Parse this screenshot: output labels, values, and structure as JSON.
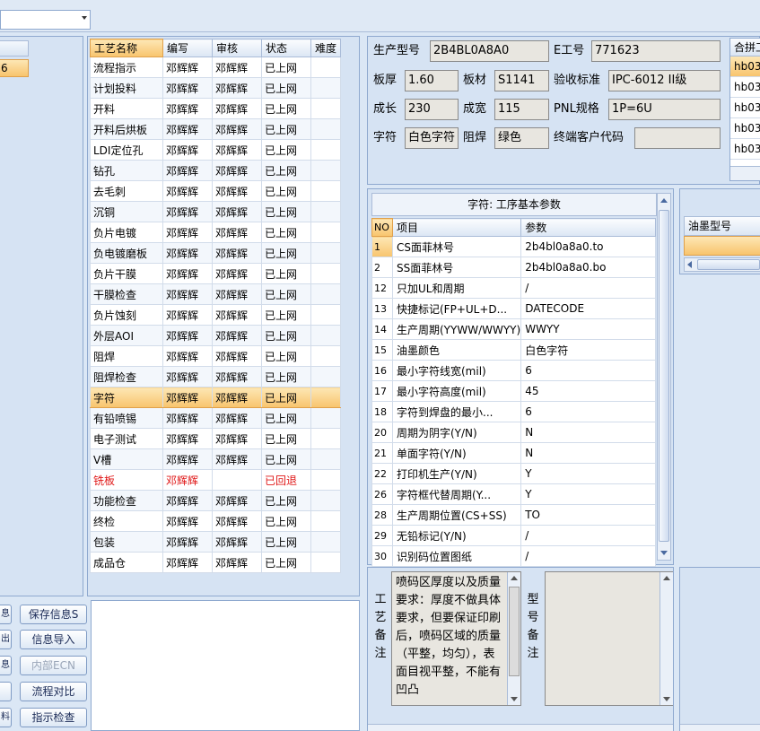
{
  "left": {
    "selected_fragment": "6",
    "buttons": [
      {
        "stub": "息",
        "label": "保存信息S",
        "disabled": false
      },
      {
        "stub": "出",
        "label": "信息导入",
        "disabled": false
      },
      {
        "stub": "息",
        "label": "内部ECN",
        "disabled": true
      },
      {
        "stub": "",
        "label": "流程对比",
        "disabled": false
      },
      {
        "stub": "料",
        "label": "指示检查",
        "disabled": false
      }
    ]
  },
  "process": {
    "headers": [
      "工艺名称",
      "编写",
      "审核",
      "状态",
      "难度"
    ],
    "rows": [
      {
        "name": "流程指示",
        "author": "邓辉辉",
        "reviewer": "邓辉辉",
        "status": "已上网"
      },
      {
        "name": "计划投料",
        "author": "邓辉辉",
        "reviewer": "邓辉辉",
        "status": "已上网"
      },
      {
        "name": "开料",
        "author": "邓辉辉",
        "reviewer": "邓辉辉",
        "status": "已上网"
      },
      {
        "name": "开料后烘板",
        "author": "邓辉辉",
        "reviewer": "邓辉辉",
        "status": "已上网"
      },
      {
        "name": "LDI定位孔",
        "author": "邓辉辉",
        "reviewer": "邓辉辉",
        "status": "已上网"
      },
      {
        "name": "钻孔",
        "author": "邓辉辉",
        "reviewer": "邓辉辉",
        "status": "已上网"
      },
      {
        "name": "去毛刺",
        "author": "邓辉辉",
        "reviewer": "邓辉辉",
        "status": "已上网"
      },
      {
        "name": "沉铜",
        "author": "邓辉辉",
        "reviewer": "邓辉辉",
        "status": "已上网"
      },
      {
        "name": "负片电镀",
        "author": "邓辉辉",
        "reviewer": "邓辉辉",
        "status": "已上网"
      },
      {
        "name": "负电镀磨板",
        "author": "邓辉辉",
        "reviewer": "邓辉辉",
        "status": "已上网"
      },
      {
        "name": "负片干膜",
        "author": "邓辉辉",
        "reviewer": "邓辉辉",
        "status": "已上网"
      },
      {
        "name": "干膜检查",
        "author": "邓辉辉",
        "reviewer": "邓辉辉",
        "status": "已上网"
      },
      {
        "name": "负片蚀刻",
        "author": "邓辉辉",
        "reviewer": "邓辉辉",
        "status": "已上网"
      },
      {
        "name": "外层AOI",
        "author": "邓辉辉",
        "reviewer": "邓辉辉",
        "status": "已上网"
      },
      {
        "name": "阻焊",
        "author": "邓辉辉",
        "reviewer": "邓辉辉",
        "status": "已上网"
      },
      {
        "name": "阻焊检查",
        "author": "邓辉辉",
        "reviewer": "邓辉辉",
        "status": "已上网"
      },
      {
        "name": "字符",
        "author": "邓辉辉",
        "reviewer": "邓辉辉",
        "status": "已上网",
        "active": true
      },
      {
        "name": "有铅喷锡",
        "author": "邓辉辉",
        "reviewer": "邓辉辉",
        "status": "已上网"
      },
      {
        "name": "电子测试",
        "author": "邓辉辉",
        "reviewer": "邓辉辉",
        "status": "已上网"
      },
      {
        "name": "V槽",
        "author": "邓辉辉",
        "reviewer": "邓辉辉",
        "status": "已上网"
      },
      {
        "name": "铣板",
        "author": "邓辉辉",
        "reviewer": "",
        "status": "已回退",
        "red": true
      },
      {
        "name": "功能检查",
        "author": "邓辉辉",
        "reviewer": "邓辉辉",
        "status": "已上网"
      },
      {
        "name": "终检",
        "author": "邓辉辉",
        "reviewer": "邓辉辉",
        "status": "已上网"
      },
      {
        "name": "包装",
        "author": "邓辉辉",
        "reviewer": "邓辉辉",
        "status": "已上网"
      },
      {
        "name": "成品仓",
        "author": "邓辉辉",
        "reviewer": "邓辉辉",
        "status": "已上网"
      }
    ]
  },
  "info": {
    "model_label": "生产型号",
    "model_value": "2B4BL0A8A0",
    "eng_label": "E工号",
    "eng_value": "771623",
    "thickness_label": "板厚",
    "thickness_value": "1.60",
    "material_label": "板材",
    "material_value": "S1141",
    "standard_label": "验收标准",
    "standard_value": "IPC-6012 II级",
    "length_label": "成长",
    "length_value": "230",
    "width_label": "成宽",
    "width_value": "115",
    "pnl_label": "PNL规格",
    "pnl_value": "1P=6U",
    "char_label": "字符",
    "char_value": "白色字符",
    "mask_label": "阻焊",
    "mask_value": "绿色",
    "customer_label": "终端客户代码",
    "customer_value": ""
  },
  "merge_list": {
    "header": "合拼工",
    "rows": [
      "hb03",
      "hb03",
      "hb03",
      "hb03",
      "hb03"
    ]
  },
  "params": {
    "title": "字符: 工序基本参数",
    "headers": [
      "NO",
      "项目",
      "参数"
    ],
    "rows": [
      {
        "no": "1",
        "item": "CS面菲林号",
        "value": "2b4bl0a8a0.to",
        "active": true
      },
      {
        "no": "2",
        "item": "SS面菲林号",
        "value": "2b4bl0a8a0.bo"
      },
      {
        "no": "12",
        "item": "只加UL和周期",
        "value": "/"
      },
      {
        "no": "13",
        "item": "快捷标记(FP+UL+D...",
        "value": "DATECODE"
      },
      {
        "no": "14",
        "item": "生产周期(YYWW/WWYY)",
        "value": "WWYY"
      },
      {
        "no": "15",
        "item": "油墨颜色",
        "value": "白色字符"
      },
      {
        "no": "16",
        "item": "最小字符线宽(mil)",
        "value": "6"
      },
      {
        "no": "17",
        "item": "最小字符高度(mil)",
        "value": "45"
      },
      {
        "no": "18",
        "item": "字符到焊盘的最小...",
        "value": "6"
      },
      {
        "no": "20",
        "item": "周期为阴字(Y/N)",
        "value": "N"
      },
      {
        "no": "21",
        "item": "单面字符(Y/N)",
        "value": "N"
      },
      {
        "no": "22",
        "item": "打印机生产(Y/N)",
        "value": "Y"
      },
      {
        "no": "26",
        "item": "字符框代替周期(Y...",
        "value": "Y"
      },
      {
        "no": "28",
        "item": "生产周期位置(CS+SS)",
        "value": "TO"
      },
      {
        "no": "29",
        "item": "无铅标记(Y/N)",
        "value": "/"
      },
      {
        "no": "30",
        "item": "识别码位置图纸",
        "value": "/"
      }
    ]
  },
  "ink": {
    "header": "油墨型号"
  },
  "remarks": {
    "process_label": [
      "工",
      "艺",
      "备",
      "注"
    ],
    "process_text": "喷码区厚度以及质量要求：厚度不做具体要求，但要保证印刷后，喷码区域的质量（平整，均匀），表面目视平整，不能有凹凸",
    "model_label": [
      "型",
      "号",
      "备",
      "注"
    ],
    "model_text": ""
  }
}
